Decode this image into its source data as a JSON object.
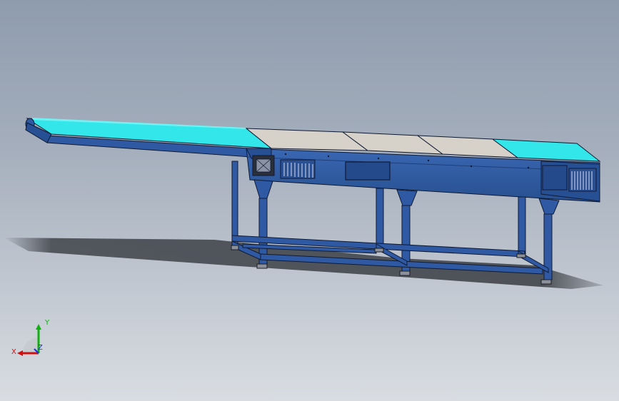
{
  "viewport": {
    "background_top": "#8f9cae",
    "background_bottom": "#d9dde2"
  },
  "model": {
    "subject": "belt-conveyor",
    "colors": {
      "frame": "#2f5aa3",
      "frame_dark": "#1f3f7a",
      "belt_cyan": "#33e6ea",
      "belt_grey": "#d6d1c9",
      "shadow": "#2a2d33",
      "outline": "#0f1a33"
    }
  },
  "triad": {
    "labels": {
      "x": "X",
      "y": "Y",
      "z": "Z"
    },
    "colors": {
      "x": "#d01010",
      "y": "#10b010",
      "z": "#2030d0"
    }
  }
}
